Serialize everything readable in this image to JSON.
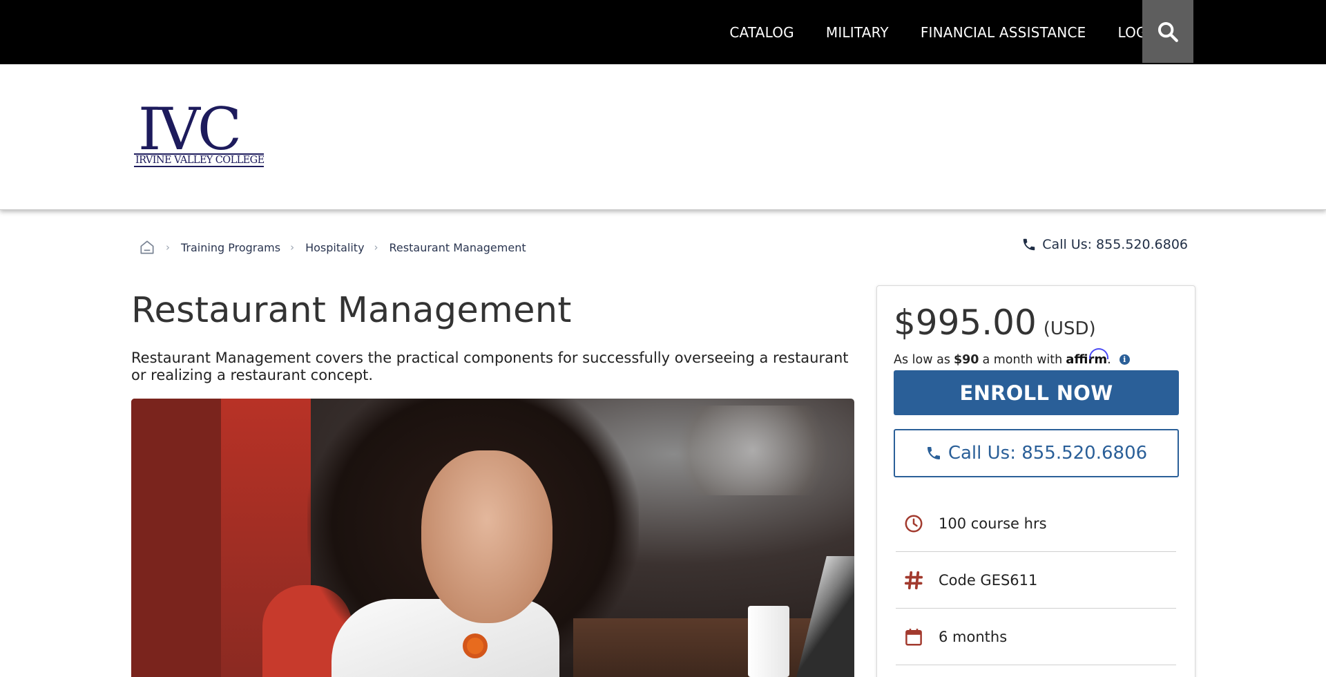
{
  "topnav": {
    "items": [
      "CATALOG",
      "MILITARY",
      "FINANCIAL ASSISTANCE",
      "LOGIN"
    ]
  },
  "logo": {
    "mark": "IVC",
    "name": "IRVINE VALLEY COLLEGE"
  },
  "breadcrumb": {
    "items": [
      "Training Programs",
      "Hospitality",
      "Restaurant Management"
    ]
  },
  "call_top": "Call Us: 855.520.6806",
  "page": {
    "title": "Restaurant Management",
    "description": "Restaurant Management covers the practical components for successfully overseeing a restaurant or realizing a restaurant concept."
  },
  "sidebar": {
    "price": "$995.00",
    "currency": "(USD)",
    "affirm": {
      "prefix": "As low as",
      "amount": "$90",
      "middle": "a month with",
      "brand": "affirm",
      "suffix": "."
    },
    "enroll_label": "ENROLL NOW",
    "call_label": "Call Us: 855.520.6806",
    "facts": [
      {
        "icon": "clock-icon",
        "label": "100 course hrs"
      },
      {
        "icon": "hashtag-icon",
        "label": "Code GES611"
      },
      {
        "icon": "calendar-icon",
        "label": "6 months"
      }
    ]
  },
  "colors": {
    "accent_blue": "#2a5f98",
    "icon_red": "#a23a2e",
    "logo_navy": "#1d1b5c",
    "topbar": "#000000"
  }
}
